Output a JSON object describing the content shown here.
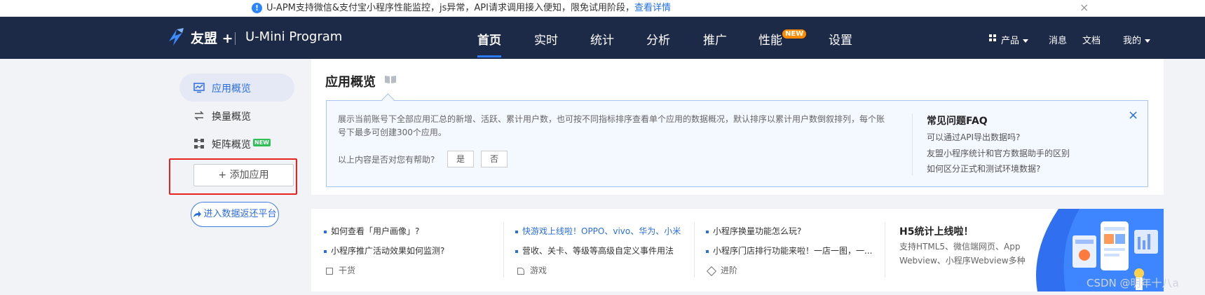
{
  "notice": {
    "text": "U-APM支持微信&支付宝小程序性能监控，js异常，API请求调用接入便知，限免试用阶段，",
    "link": "查看详情",
    "close": "×"
  },
  "brand": {
    "logo": "友盟 +",
    "product": "U-Mini Program"
  },
  "nav": {
    "items": [
      "首页",
      "实时",
      "统计",
      "分析",
      "推广",
      "性能",
      "设置"
    ],
    "new_badge": "NEW",
    "right": {
      "products": "产品",
      "messages": "消息",
      "docs": "文档",
      "mine": "我的"
    }
  },
  "sidebar": {
    "items": [
      {
        "label": "应用概览"
      },
      {
        "label": "换量概览"
      },
      {
        "label": "矩阵概览"
      }
    ],
    "new_tag": "NEW",
    "add_app": "+ 添加应用",
    "data_platform": "进入数据返还平台"
  },
  "main": {
    "title": "应用概览",
    "description": "展示当前账号下全部应用汇总的新增、活跃、累计用户数，也可按不同指标排序查看单个应用的数据概况，默认排序以累计用户数倒叙排列，每个账号下最多可创建300个应用。",
    "help_question": "以上内容是否对您有帮助?",
    "yes": "是",
    "no": "否",
    "faq": {
      "title": "常见问题FAQ",
      "links": [
        "可以通过API导出数据吗?",
        "友盟小程序统计和官方数据助手的区别",
        "如何区分正式和测试环境数据?"
      ]
    },
    "close": "×"
  },
  "bottom": {
    "columns": [
      {
        "items": [
          "如何查看「用户画像」?",
          "小程序推广活动效果如何监测?"
        ],
        "category": "干货"
      },
      {
        "items": [
          "快游戏上线啦！OPPO、vivo、华为、小米",
          "营收、关卡、等级等高级自定义事件用法"
        ],
        "category": "游戏"
      },
      {
        "items": [
          "小程序换量功能怎么玩?",
          "小程序门店排行功能来啦！一店一图，一..."
        ],
        "category": "进阶"
      }
    ],
    "h5": {
      "title": "H5统计上线啦！",
      "desc": "支持HTML5、微信端网页、App Webview、小程序Webview多种"
    }
  },
  "watermark": "CSDN @明年十八a",
  "colors": {
    "nav_bg": "#1c2a47",
    "accent": "#2b6de0",
    "new_badge": "#ff8a00",
    "highlight_box": "#e8231f"
  }
}
